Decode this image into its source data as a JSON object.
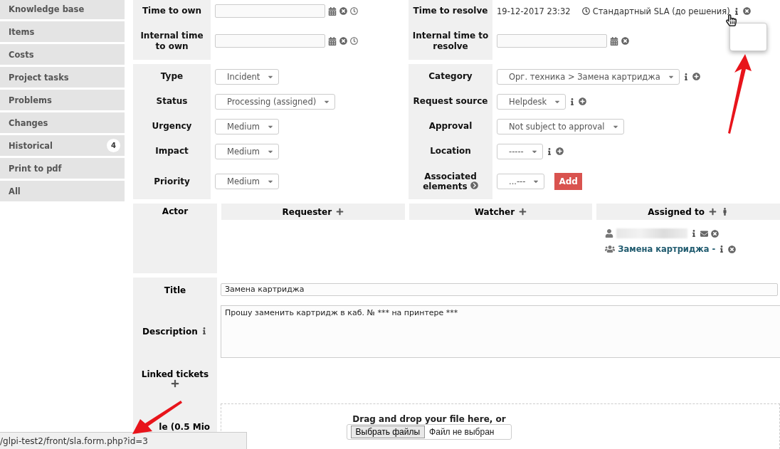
{
  "sidebar": {
    "items": [
      {
        "label": "Knowledge base"
      },
      {
        "label": "Items"
      },
      {
        "label": "Costs"
      },
      {
        "label": "Project tasks"
      },
      {
        "label": "Problems"
      },
      {
        "label": "Changes"
      },
      {
        "label": "Historical",
        "badge": "4"
      },
      {
        "label": "Print to pdf"
      },
      {
        "label": "All"
      }
    ]
  },
  "time_section": {
    "rows": [
      {
        "left": {
          "label": "Time to own",
          "kind": "date_clock"
        },
        "right": {
          "label": "Time to resolve",
          "kind": "sla",
          "date": "19-12-2017 23:32",
          "sla": "Стандартный SLA (до решения)"
        }
      },
      {
        "left": {
          "label": "Internal time to own",
          "kind": "date_clock"
        },
        "right": {
          "label": "Internal time to resolve",
          "kind": "date"
        }
      }
    ]
  },
  "details_section": {
    "rows": [
      {
        "left": {
          "label": "Type",
          "kind": "select",
          "value": "Incident"
        },
        "right": {
          "label": "Category",
          "kind": "select_icons",
          "value": "Орг. техника > Замена картриджа"
        }
      },
      {
        "left": {
          "label": "Status",
          "kind": "select",
          "value": "Processing (assigned)"
        },
        "right": {
          "label": "Request source",
          "kind": "select_icons",
          "value": "Helpdesk"
        }
      },
      {
        "left": {
          "label": "Urgency",
          "kind": "select",
          "value": "Medium"
        },
        "right": {
          "label": "Approval",
          "kind": "select",
          "value": "Not subject to approval"
        }
      },
      {
        "left": {
          "label": "Impact",
          "kind": "select",
          "value": "Medium"
        },
        "right": {
          "label": "Location",
          "kind": "select_icons",
          "value": "-----"
        }
      },
      {
        "left": {
          "label": "Priority",
          "kind": "select",
          "value": "Medium"
        },
        "right": {
          "label": "Associated elements",
          "kind": "select_add",
          "value": "...---",
          "button": "Add"
        }
      }
    ]
  },
  "actors": {
    "label": "Actor",
    "columns": [
      {
        "title": "Requester",
        "kind": "plain"
      },
      {
        "title": "Watcher",
        "kind": "plain"
      },
      {
        "title": "Assigned to",
        "kind": "assign",
        "members": [
          {
            "kind": "user"
          },
          {
            "kind": "group",
            "name": "Замена картриджа -"
          }
        ]
      }
    ]
  },
  "ticket": {
    "title_label": "Title",
    "title": "Замена картриджа",
    "description_label": "Description",
    "description": "Прошу заменить картридж в каб. № *** на принтере ***",
    "linked_label": "Linked tickets",
    "file_label": "le (0.5 Mio",
    "dropzone_text": "Drag and drop your file here, or",
    "file_button": "Выбрать файлы",
    "file_status": "Файл не выбран"
  },
  "status_bar": {
    "url": "/glpi-test2/front/sla.form.php?id=3"
  }
}
